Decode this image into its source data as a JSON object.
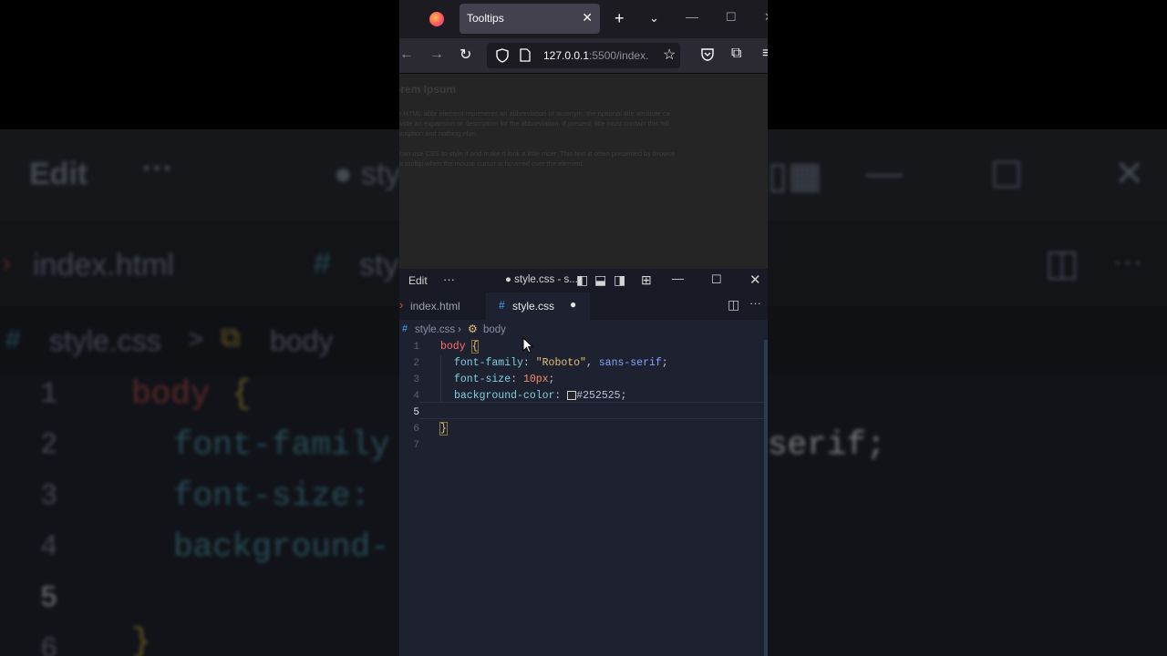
{
  "background": {
    "menu_label": "Edit",
    "more": "···",
    "filename_tab": "sty",
    "tab_index": "index.html",
    "tab_style_hash": "#",
    "tab_style": "sty",
    "breadcrumb_file": "style.css",
    "breadcrumb_sep": ">",
    "breadcrumb_body": "body",
    "line1": "1",
    "line2": "2",
    "line3": "3",
    "line4": "4",
    "line5": "5",
    "line6": "6",
    "code_body": "body",
    "code_brace": "{",
    "code_family": "font-family",
    "code_size": "font-size:",
    "code_bg": "background-",
    "code_serif": "serif;",
    "close_brace": "}"
  },
  "browser": {
    "tab_title": "Tooltips",
    "url_host": "127.0.0.1",
    "url_rest": ":5500/index.",
    "new_tab": "+",
    "icons": [
      "firefox-logo",
      "back-arrow",
      "forward-arrow",
      "reload",
      "shield",
      "page",
      "star",
      "pocket",
      "extensions",
      "menu"
    ]
  },
  "page": {
    "heading": "orem Ipsum",
    "para1_line1": "he HTML abbr element represents an abbreviation or acronym; the optional title attribute ca",
    "para1_line2": "rovide an expansion or description for the abbreviation. If present, title must contain this full",
    "para1_line3": "escription and nothing else.",
    "para2_line1": "e can use CSS to style it and make it look a little nicer. This text is often presented by browse",
    "para2_line2": "s a tooltip when the mouse cursor is hovered over the element."
  },
  "vscode": {
    "menu_edit": "Edit",
    "menu_more": "···",
    "title": "● style.css - s...",
    "tab_index": "index.html",
    "tab_style": "style.css",
    "breadcrumb_file": "style.css",
    "breadcrumb_symbol": "body",
    "lines": [
      "1",
      "2",
      "3",
      "4",
      "5",
      "6",
      "7"
    ],
    "code": {
      "selector": "body",
      "open_brace": "{",
      "prop1": "font-family",
      "val1_str": "\"Roboto\"",
      "val1_rest": "sans-serif",
      "prop2": "font-size",
      "val2": "10px",
      "prop3": "background-color",
      "val3": "#252525",
      "close_brace": "}"
    }
  },
  "colors": {
    "page_bg": "#252525",
    "editor_bg": "#1e2130",
    "firefox_tab": "#42414d"
  }
}
